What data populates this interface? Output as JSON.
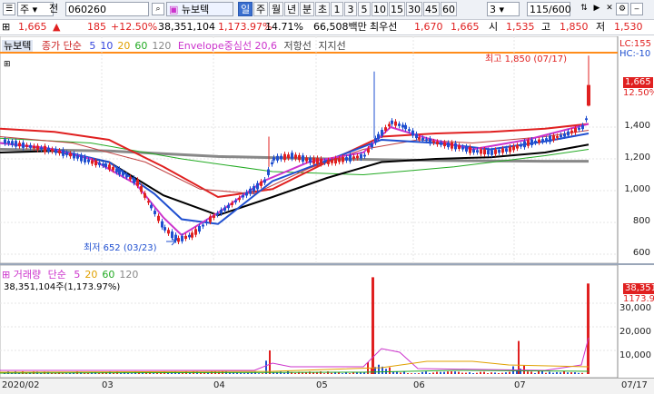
{
  "toolbar": {
    "market_label": "주",
    "market_mode": "전",
    "code": "060260",
    "name": "뉴보텍",
    "periods": [
      "일",
      "주",
      "월",
      "년",
      "분",
      "초"
    ],
    "active_period": "일",
    "intervals": [
      "1",
      "3",
      "5",
      "10",
      "15",
      "30",
      "45",
      "60"
    ],
    "interval_select": "3",
    "page_count": "115/600"
  },
  "quote": {
    "prev_price": "1,665",
    "change": "185",
    "change_pct": "+12.50%",
    "volume": "38,351,104",
    "volume_ratio": "1,173.97%",
    "turnover": "14.71%",
    "amount": "66,508백만",
    "best_bid_label": "최우선",
    "bid": "1,670",
    "ask": "1,665",
    "open_label": "시",
    "open": "1,535",
    "high_label": "고",
    "high": "1,850",
    "low_label": "저",
    "low": "1,530"
  },
  "price_pane": {
    "name": "뉴보텍",
    "legend_prefix": "종가 단순",
    "ma": [
      {
        "period": "5",
        "color": "#3344dd"
      },
      {
        "period": "10",
        "color": "#3344dd"
      },
      {
        "period": "20",
        "color": "#e0a000"
      },
      {
        "period": "60",
        "color": "#22aa22"
      },
      {
        "period": "120",
        "color": "#888888"
      }
    ],
    "envelope": "Envelope중심선 20,6",
    "resistance": "저항선",
    "support": "지지선",
    "lc_label": "LC:155",
    "hc_label": "HC:-10",
    "high_note": "최고 1,850 (07/17)",
    "low_note": "최저 652 (03/23)",
    "current_price": "1,665",
    "current_pct": "12.50%",
    "yaxis": [
      "1,400",
      "1,200",
      "1,000",
      "800",
      "600"
    ]
  },
  "volume_pane": {
    "name": "거래량",
    "legend_prefix": "단순",
    "ma": [
      {
        "period": "5",
        "color": "#cc33cc"
      },
      {
        "period": "20",
        "color": "#e0a000"
      },
      {
        "period": "60",
        "color": "#22aa22"
      },
      {
        "period": "120",
        "color": "#888888"
      }
    ],
    "current": "38,351,104주(1,173.97%)",
    "tag_value": "38,351",
    "tag_pct": "1173.9",
    "yaxis": [
      "30,000",
      "20,000",
      "10,000"
    ]
  },
  "xaxis": [
    "2020/02",
    "03",
    "04",
    "05",
    "06",
    "07",
    "07/17"
  ],
  "colors": {
    "up": "#e02020",
    "down": "#1f4fd0",
    "accent": "#3a6fd0"
  }
}
